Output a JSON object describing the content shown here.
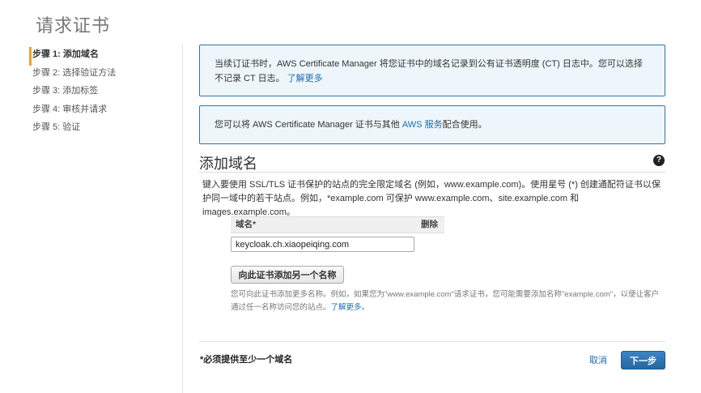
{
  "page": {
    "title": "请求证书"
  },
  "steps": [
    {
      "label": "步骤 1:  添加域名",
      "active": true
    },
    {
      "label": "步骤 2:  选择验证方法",
      "active": false
    },
    {
      "label": "步骤 3: 添加标签",
      "active": false
    },
    {
      "label": "步骤 4:  审核并请求",
      "active": false
    },
    {
      "label": "步骤 5:  验证",
      "active": false
    }
  ],
  "info_ct": {
    "text": "当续订证书时，AWS Certificate Manager 将您证书中的域名记录到公有证书透明度 (CT) 日志中。您可以选择不记录 CT 日志。",
    "link": "了解更多"
  },
  "info_services": {
    "text_before": "您可以将 AWS Certificate Manager 证书与其他 ",
    "link": "AWS 服务",
    "text_after": "配合使用。"
  },
  "section": {
    "title": "添加域名",
    "help_icon": "?",
    "description": "键入要使用 SSL/TLS 证书保护的站点的完全限定域名 (例如，www.example.com)。使用星号 (*) 创建通配符证书以保护同一域中的若干站点。例如，*example.com 可保护 www.example.com、site.example.com 和 images.example.com。"
  },
  "domain_table": {
    "col_name": "域名*",
    "col_delete": "删除",
    "value": "keycloak.ch.xiaopeiqing.com"
  },
  "add_button": {
    "label": "向此证书添加另一个名称"
  },
  "add_hint": {
    "text": "您可向此证书添加更多名称。例如，如果您为\"www.example.com\"请求证书，您可能需要添加名称\"example.com\"，以便让客户通过任一名称访问您的站点。",
    "link": "了解更多。"
  },
  "footer": {
    "required_note": "*必须提供至少一个域名",
    "cancel_label": "取消",
    "next_label": "下一步"
  },
  "colors": {
    "accent": "#1a6bb5",
    "step_marker": "#f0a030",
    "info_border": "#2f73a8",
    "info_bg": "#eef6fb"
  }
}
